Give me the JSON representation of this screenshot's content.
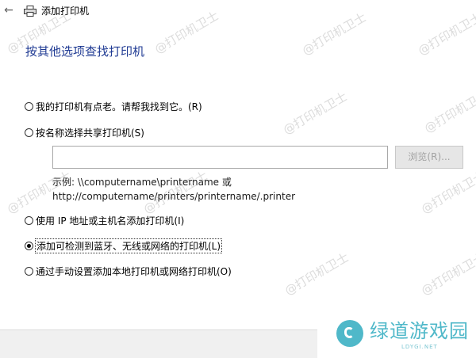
{
  "window": {
    "title": "添加打印机",
    "back_icon": "back-arrow-icon",
    "printer_icon": "printer-icon"
  },
  "heading": "按其他选项查找打印机",
  "options": [
    {
      "label": "我的打印机有点老。请帮我找到它。(R)",
      "checked": false
    },
    {
      "label": "按名称选择共享打印机(S)",
      "checked": false
    },
    {
      "label": "使用 IP 地址或主机名添加打印机(I)",
      "checked": false
    },
    {
      "label": "添加可检测到蓝牙、无线或网络的打印机(L)",
      "checked": true
    },
    {
      "label": "通过手动设置添加本地打印机或网络打印机(O)",
      "checked": false
    }
  ],
  "share_name_input": {
    "value": "",
    "placeholder": ""
  },
  "browse_button": {
    "label": "浏览(R)..."
  },
  "example": {
    "line1": "示例: \\\\computername\\printername 或",
    "line2": "http://computername/printers/printername/.printer"
  },
  "watermark": "@打印机卫士",
  "logo": {
    "text": "绿道游戏园",
    "sub": "LDYGI.NET"
  },
  "colors": {
    "heading": "#1f3a93",
    "logo": "#4fb8c9"
  }
}
